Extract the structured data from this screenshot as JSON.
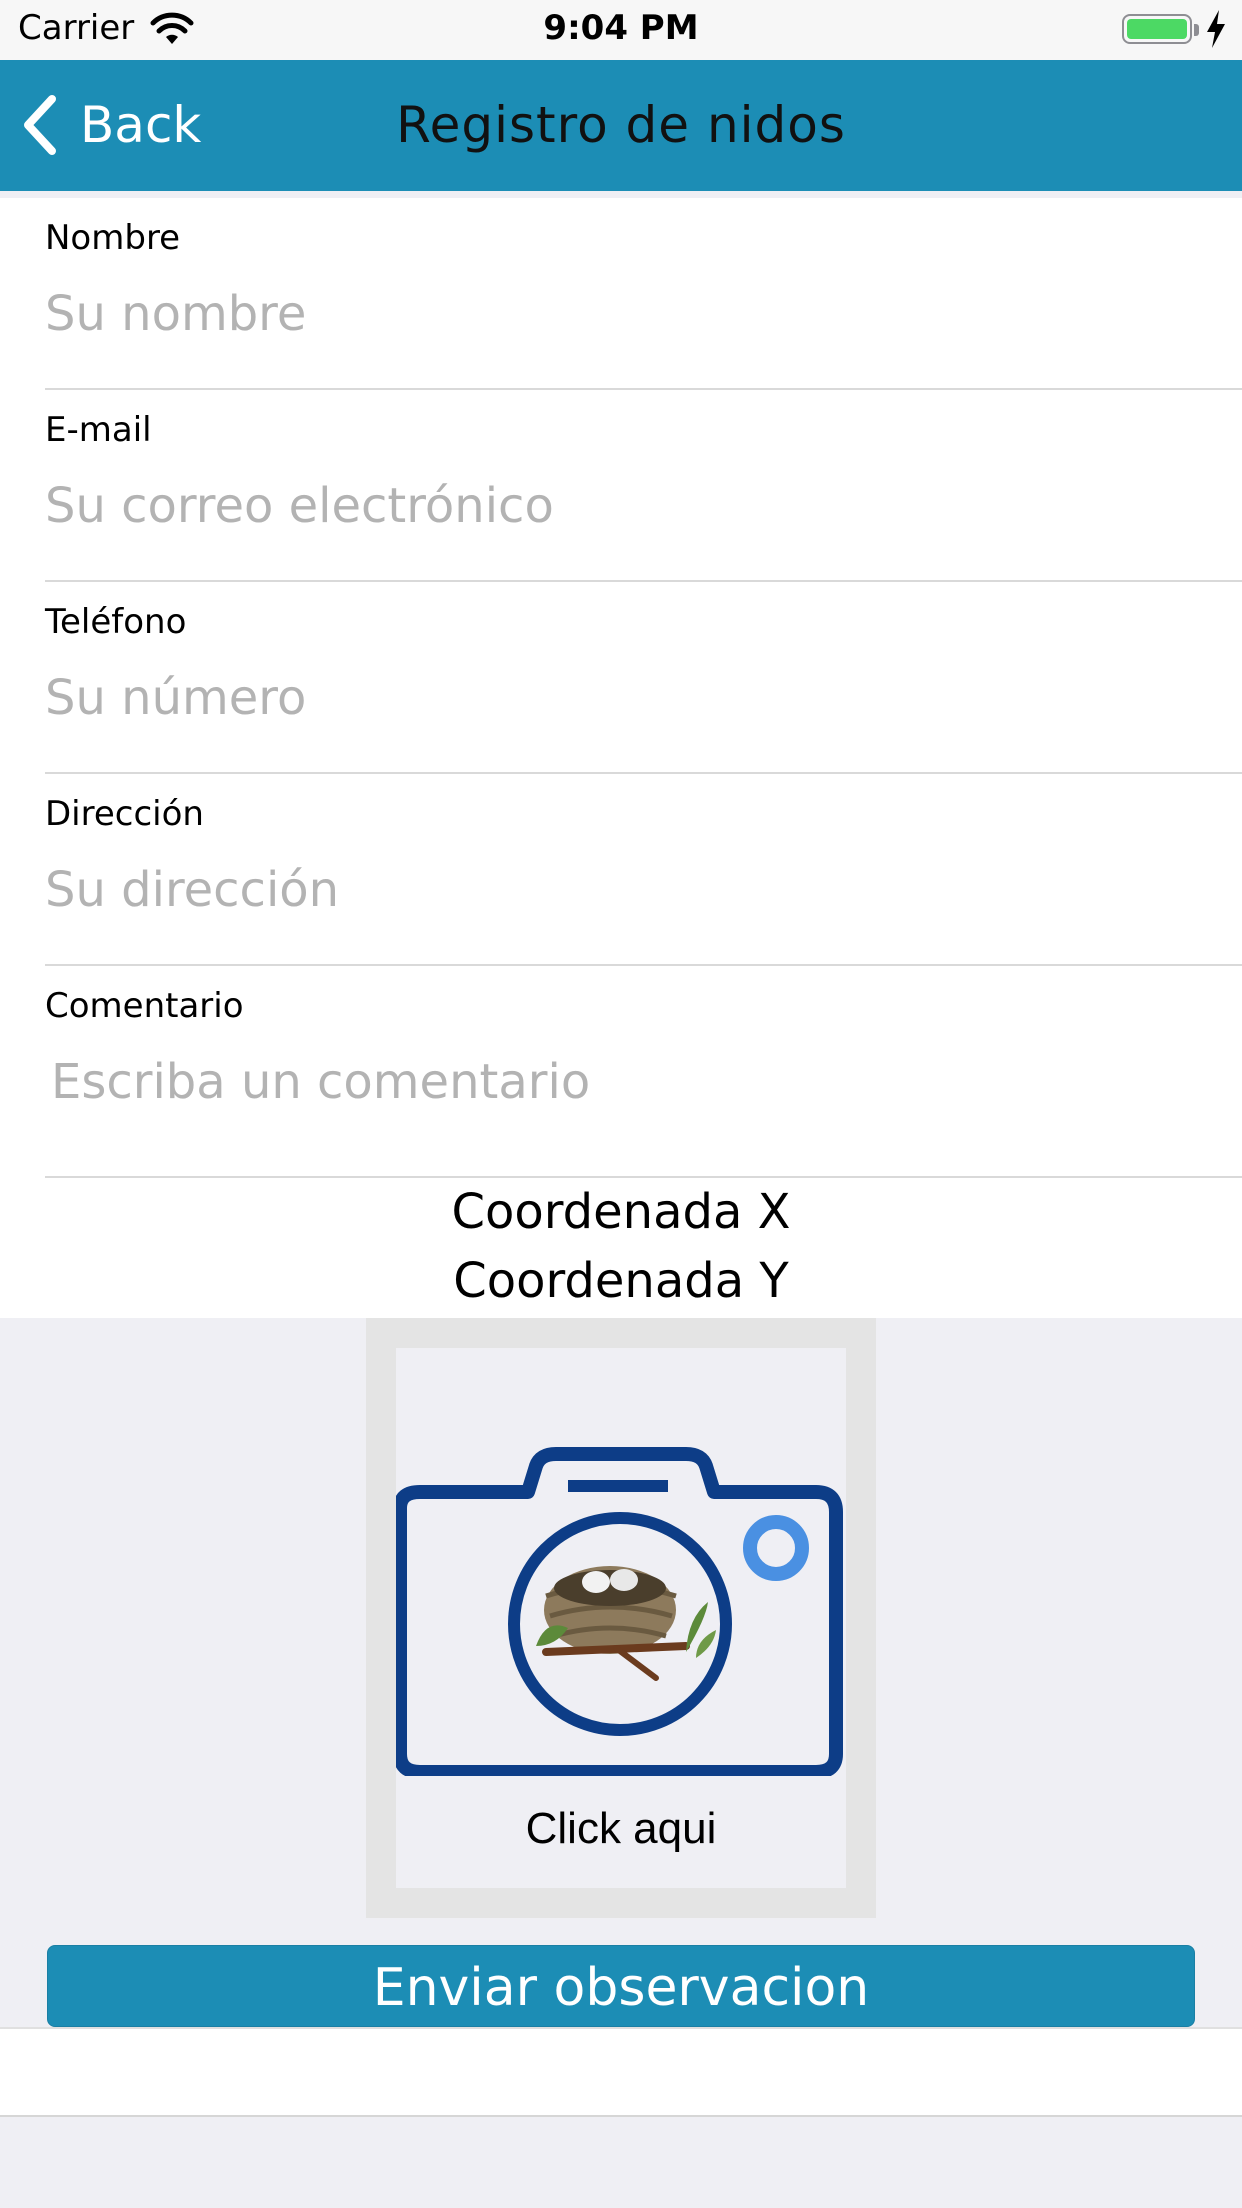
{
  "status_bar": {
    "carrier": "Carrier",
    "time": "9:04 PM",
    "icons": [
      "wifi-icon",
      "battery-icon",
      "charging-bolt-icon"
    ]
  },
  "nav": {
    "back_label": "Back",
    "title": "Registro de nidos",
    "back_icon": "chevron-left-icon"
  },
  "form": {
    "fields": [
      {
        "label": "Nombre",
        "placeholder": "Su nombre",
        "value": ""
      },
      {
        "label": "E-mail",
        "placeholder": "Su correo electrónico",
        "value": ""
      },
      {
        "label": "Teléfono",
        "placeholder": "Su número",
        "value": ""
      },
      {
        "label": "Dirección",
        "placeholder": "Su dirección",
        "value": ""
      },
      {
        "label": "Comentario",
        "placeholder": "Escriba un comentario",
        "value": ""
      }
    ],
    "coord_x": "Coordenada X",
    "coord_y": "Coordenada Y"
  },
  "photo": {
    "icon": "camera-nest-icon",
    "label": "Click aqui"
  },
  "submit": {
    "label": "Enviar observacion"
  },
  "colors": {
    "accent": "#1c8db5",
    "camera_blue": "#0d3d87",
    "camera_light_blue": "#4a90e2",
    "placeholder": "#b3b3b3",
    "background": "#efeff4"
  }
}
